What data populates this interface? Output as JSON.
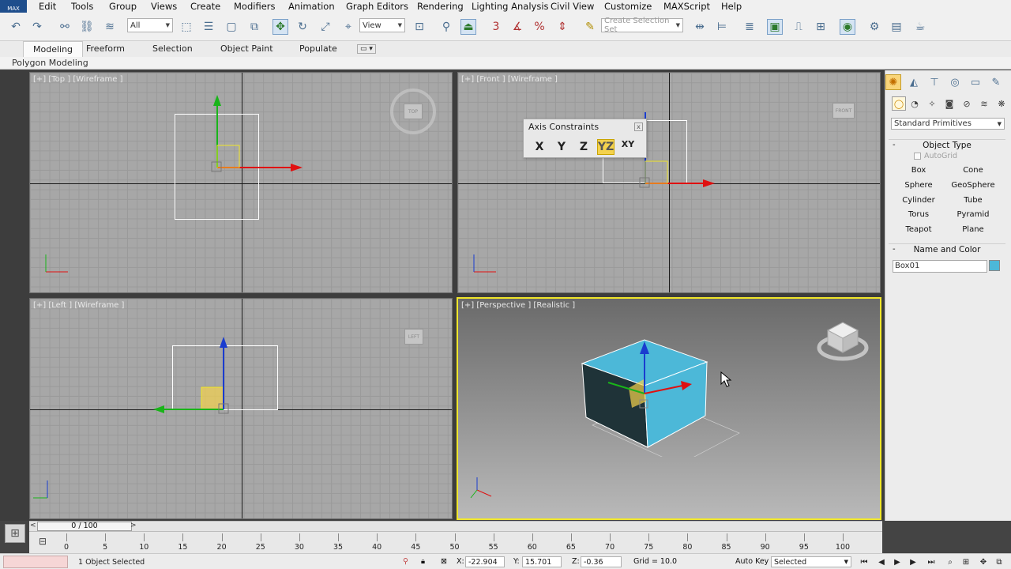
{
  "app": {
    "logo_text": "MAX"
  },
  "menu": {
    "items": [
      {
        "label": "Edit"
      },
      {
        "label": "Tools"
      },
      {
        "label": "Group"
      },
      {
        "label": "Views"
      },
      {
        "label": "Create"
      },
      {
        "label": "Modifiers"
      },
      {
        "label": "Animation"
      },
      {
        "label": "Graph Editors"
      },
      {
        "label": "Rendering"
      },
      {
        "label": "Lighting Analysis"
      },
      {
        "label": "Civil View"
      },
      {
        "label": "Customize"
      },
      {
        "label": "MAXScript"
      },
      {
        "label": "Help"
      }
    ]
  },
  "toolbar": {
    "selection_filter": "All",
    "ref_coord": "View",
    "selection_set_placeholder": "Create Selection Set",
    "snap_label": "3",
    "percent_snap_label": "%"
  },
  "ribbon": {
    "tabs": [
      {
        "label": "Modeling",
        "active": true
      },
      {
        "label": "Freeform"
      },
      {
        "label": "Selection"
      },
      {
        "label": "Object Paint"
      },
      {
        "label": "Populate"
      }
    ],
    "panel": "Polygon Modeling"
  },
  "viewports": {
    "top": {
      "label": "[+] [Top ] [Wireframe ]",
      "cube": "TOP"
    },
    "front": {
      "label": "[+] [Front ] [Wireframe ]",
      "cube": "FRONT"
    },
    "left": {
      "label": "[+] [Left ] [Wireframe ]",
      "cube": "LEFT"
    },
    "perspective": {
      "label": "[+] [Perspective ] [Realistic ]"
    }
  },
  "axis_constraints": {
    "title": "Axis Constraints",
    "close": "x",
    "buttons": [
      {
        "label": "X",
        "active": false
      },
      {
        "label": "Y",
        "active": false
      },
      {
        "label": "Z",
        "active": false
      },
      {
        "label": "YZ",
        "active": true
      },
      {
        "label": "XY",
        "active": false
      }
    ]
  },
  "command_panel": {
    "category_dropdown": "Standard Primitives",
    "object_type": {
      "title": "Object Type",
      "autogrid": "AutoGrid",
      "buttons": [
        "Box",
        "Cone",
        "Sphere",
        "GeoSphere",
        "Cylinder",
        "Tube",
        "Torus",
        "Pyramid",
        "Teapot",
        "Plane"
      ]
    },
    "name_color": {
      "title": "Name and Color",
      "name_value": "Box01",
      "color": "#4cb8d8"
    },
    "minus": "-"
  },
  "timeslider": {
    "current": "0 / 100",
    "prev": "<",
    "next": ">"
  },
  "trackbar": {
    "ticks": [
      "0",
      "5",
      "10",
      "15",
      "20",
      "25",
      "30",
      "35",
      "40",
      "45",
      "50",
      "55",
      "60",
      "65",
      "70",
      "75",
      "80",
      "85",
      "90",
      "95",
      "100"
    ]
  },
  "status": {
    "selection": "1 Object Selected",
    "x_label": "X:",
    "x": "-22.904",
    "y_label": "Y:",
    "y": "15.701",
    "z_label": "Z:",
    "z": "-0.36",
    "grid": "Grid = 10.0",
    "auto_key": "Auto Key",
    "key_filter": "Selected"
  },
  "colors": {
    "box_cyan": "#4cb8d8",
    "active_viewport_border": "#f0e62a",
    "axis_x": "#e01010",
    "axis_y": "#19b419",
    "axis_z": "#1a3ccf"
  }
}
